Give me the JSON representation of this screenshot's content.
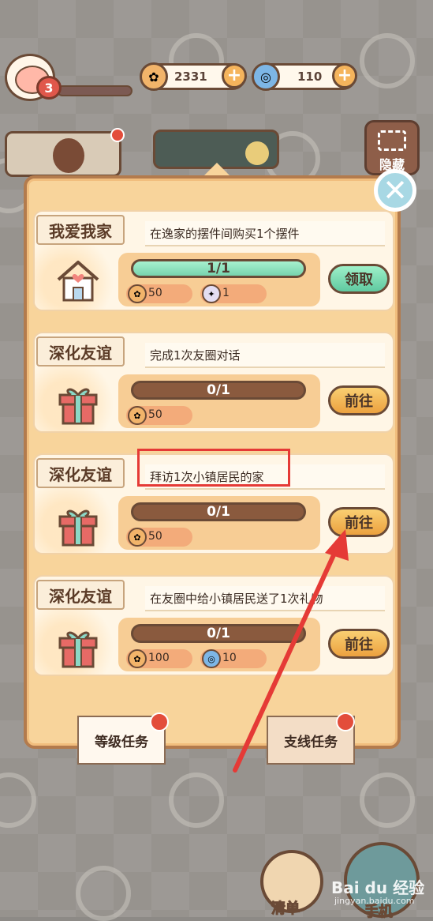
{
  "hud": {
    "level": "3",
    "coins": "2331",
    "gems": "110",
    "hide_label": "隐藏"
  },
  "tasks": [
    {
      "title": "我爱我家",
      "desc": "在逸家的摆件间购买1个摆件",
      "progress": "1/1",
      "progress_fraction": 1,
      "rewards": [
        {
          "icon": "coin-icon",
          "value": "50"
        },
        {
          "icon": "ticket-icon",
          "value": "1"
        }
      ],
      "action": "领取"
    },
    {
      "title": "深化友谊",
      "desc": "完成1次友圈对话",
      "progress": "0/1",
      "progress_fraction": 0,
      "rewards": [
        {
          "icon": "coin-icon",
          "value": "50"
        }
      ],
      "action": "前往"
    },
    {
      "title": "深化友谊",
      "desc": "拜访1次小镇居民的家",
      "progress": "0/1",
      "progress_fraction": 0,
      "rewards": [
        {
          "icon": "coin-icon",
          "value": "50"
        }
      ],
      "action": "前往"
    },
    {
      "title": "深化友谊",
      "desc": "在友圈中给小镇居民送了1次礼物",
      "progress": "0/1",
      "progress_fraction": 0,
      "rewards": [
        {
          "icon": "coin-icon",
          "value": "100"
        },
        {
          "icon": "gem-icon",
          "value": "10"
        }
      ],
      "action": "前往"
    }
  ],
  "tabs": {
    "level_tasks": "等级任务",
    "side_tasks": "支线任务"
  },
  "bottom": {
    "checklist": "清单",
    "phone": "手机"
  },
  "watermark": {
    "main": "Bai du 经验",
    "sub": "jingyan.baidu.com"
  },
  "colors": {
    "accent_red": "#e53a36",
    "panel": "#f8d49b",
    "button_orange": "#eca13f",
    "button_green": "#5fc9a0"
  }
}
